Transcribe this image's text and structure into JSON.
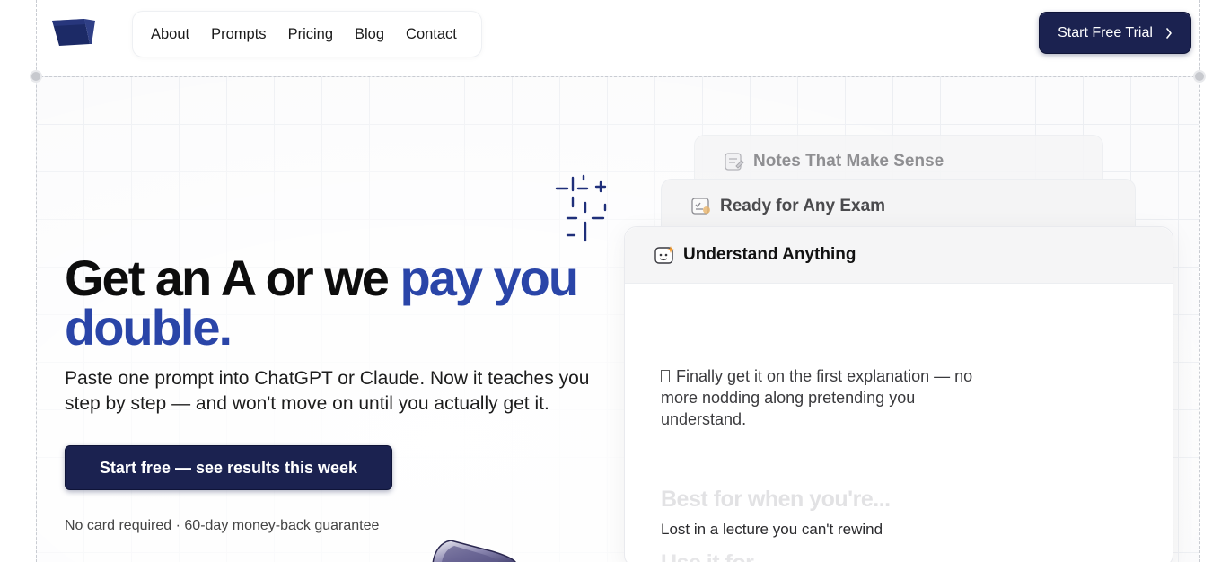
{
  "header": {
    "logo_icon": "brand-logo-icon",
    "nav": [
      "About",
      "Prompts",
      "Pricing",
      "Blog",
      "Contact"
    ],
    "cta_label": "Start Free Trial",
    "cta_icon": "chevron-right-icon"
  },
  "hero": {
    "title_plain": "Get an A or we ",
    "title_accent": "pay you double.",
    "subtitle": "Paste one prompt into ChatGPT or Claude. Now it teaches you step by step — and won't move on until you actually get it.",
    "cta_label": "Start free — see results this week",
    "note": "No card required · 60-day money-back guarantee"
  },
  "features": {
    "tabs": [
      {
        "label": "Notes That Make Sense",
        "icon": "notes-icon"
      },
      {
        "label": "Ready for Any Exam",
        "icon": "exam-icon"
      },
      {
        "label": "Understand Anything",
        "icon": "sparkle-card-icon"
      }
    ],
    "active_index": 2,
    "description": "Finally get it on the first explanation — no more nodding along pretending you understand.",
    "best_heading": "Best for when you're...",
    "best_text": "Lost in a lecture you can't rewind",
    "use_heading": "Use it for..."
  },
  "colors": {
    "accent": "#2a45a8",
    "button_bg": "#1b2250"
  }
}
